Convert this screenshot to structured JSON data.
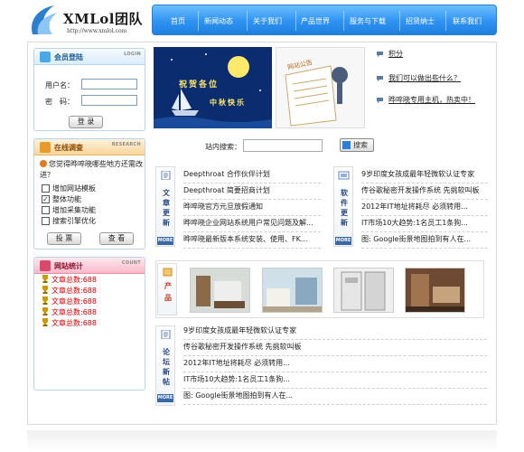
{
  "header": {
    "brand": "XMLol团队",
    "url": "http://www.xmlol.com",
    "nav": [
      "首页",
      "新闻动态",
      "关于我们",
      "产品世界",
      "服务与下载",
      "招贤纳士",
      "联系我们"
    ]
  },
  "login": {
    "title": "会员登陆",
    "english": "LOGIN",
    "username_label": "用户名：",
    "password_label": "密　码：",
    "submit": "登 录"
  },
  "survey": {
    "title": "在线调查",
    "english": "RESEARCH",
    "question": "您觉得晔啐晓哪些地方还需改进？",
    "options": [
      {
        "label": "增加网站模板",
        "checked": false
      },
      {
        "label": "整体功能",
        "checked": true
      },
      {
        "label": "增加采集功能",
        "checked": false
      },
      {
        "label": "搜索引擎优化",
        "checked": false
      }
    ],
    "vote": "投 票",
    "view": "查 看"
  },
  "stats": {
    "title": "网站统计",
    "english": "COUNT",
    "rows": [
      "文章总数:688",
      "文章总数:688",
      "文章总数:688",
      "文章总数:688",
      "文章总数:688"
    ]
  },
  "banner_left": {
    "greeting": "祝贺各位",
    "festival": "中秋快乐"
  },
  "banner_right": {
    "title": "网站公告"
  },
  "promo_links": [
    "积分",
    "我们可以做出些什么？",
    "晔啐晓专用主机，热卖中！"
  ],
  "search": {
    "label": "站内搜索：",
    "value": "",
    "button": "搜索"
  },
  "articles": {
    "tab": [
      "文",
      "章",
      "更",
      "新"
    ],
    "more": "MORE",
    "items": [
      "Deepthroat 合作伙伴计划",
      "Deepthroat 简要招商计划",
      "晔啐晓官方元旦放假通知",
      "晔啐晓企业网站系统用户常见问题及解...",
      "晔啐晓最新版本系统安装、使用、FK..."
    ]
  },
  "software": {
    "tab": [
      "软",
      "件",
      "更",
      "新"
    ],
    "more": "MORE",
    "items": [
      "9岁印度女孩成最年轻微软认证专家",
      "传谷歌秘密开发操作系统 先挑软叫板",
      "2012年IT地址将耗尽 必须转用...",
      "IT市场10大趋势:1名员工1条狗...",
      "图: Google街景地图拍到有人在..."
    ]
  },
  "products": {
    "tab": [
      "产",
      "品"
    ],
    "thumbs": [
      "product-room-1",
      "product-room-2",
      "product-room-3",
      "product-room-4",
      "product-room-5"
    ]
  },
  "forum": {
    "tab": [
      "论",
      "坛",
      "新",
      "帖"
    ],
    "more": "MORE",
    "items": [
      "9岁印度女孩成最年轻微软认证专家",
      "传谷歌秘密开发操作系统 先挑软叫板",
      "2012年IT地址将耗尽 必须转用...",
      "IT市场10大趋势:1名员工1条狗...",
      "图: Google街景地图拍到有人在..."
    ]
  },
  "colors": {
    "nav_blue": "#2f93f2",
    "stats_red": "#cc0000",
    "more_blue": "#3a67a6"
  }
}
